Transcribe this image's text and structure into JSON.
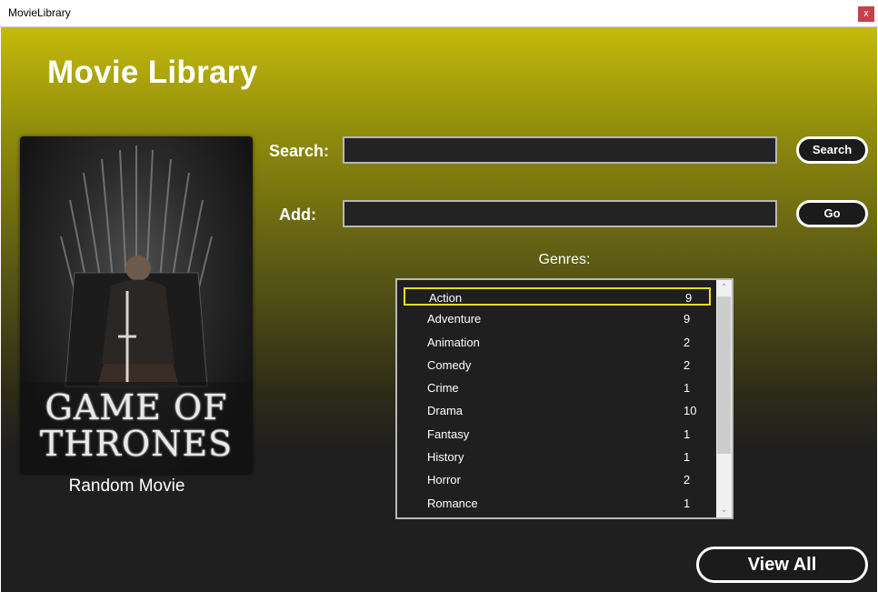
{
  "window": {
    "title": "MovieLibrary",
    "close_label": "x"
  },
  "header": {
    "title": "Movie Library"
  },
  "poster": {
    "title_line1": "GAME OF",
    "title_line2": "THRONES",
    "caption": "Random Movie"
  },
  "search": {
    "label": "Search:",
    "value": "",
    "button_label": "Search"
  },
  "add": {
    "label": "Add:",
    "value": "",
    "button_label": "Go"
  },
  "genres": {
    "label": "Genres:",
    "items": [
      {
        "name": "Action",
        "count": "9"
      },
      {
        "name": "Adventure",
        "count": "9"
      },
      {
        "name": "Animation",
        "count": "2"
      },
      {
        "name": "Comedy",
        "count": "2"
      },
      {
        "name": "Crime",
        "count": "1"
      },
      {
        "name": "Drama",
        "count": "10"
      },
      {
        "name": "Fantasy",
        "count": "1"
      },
      {
        "name": "History",
        "count": "1"
      },
      {
        "name": "Horror",
        "count": "2"
      },
      {
        "name": "Romance",
        "count": "1"
      }
    ],
    "selected_index": 0
  },
  "footer": {
    "view_all_label": "View All"
  },
  "colors": {
    "header_gradient_top": "#c4ba0c",
    "background_dark": "#201f20",
    "selection_border": "#e6e01a",
    "close_button": "#c6414b"
  },
  "icons": {
    "close": "close-icon",
    "scroll_up": "chevron-up-icon",
    "scroll_down": "chevron-down-icon"
  }
}
